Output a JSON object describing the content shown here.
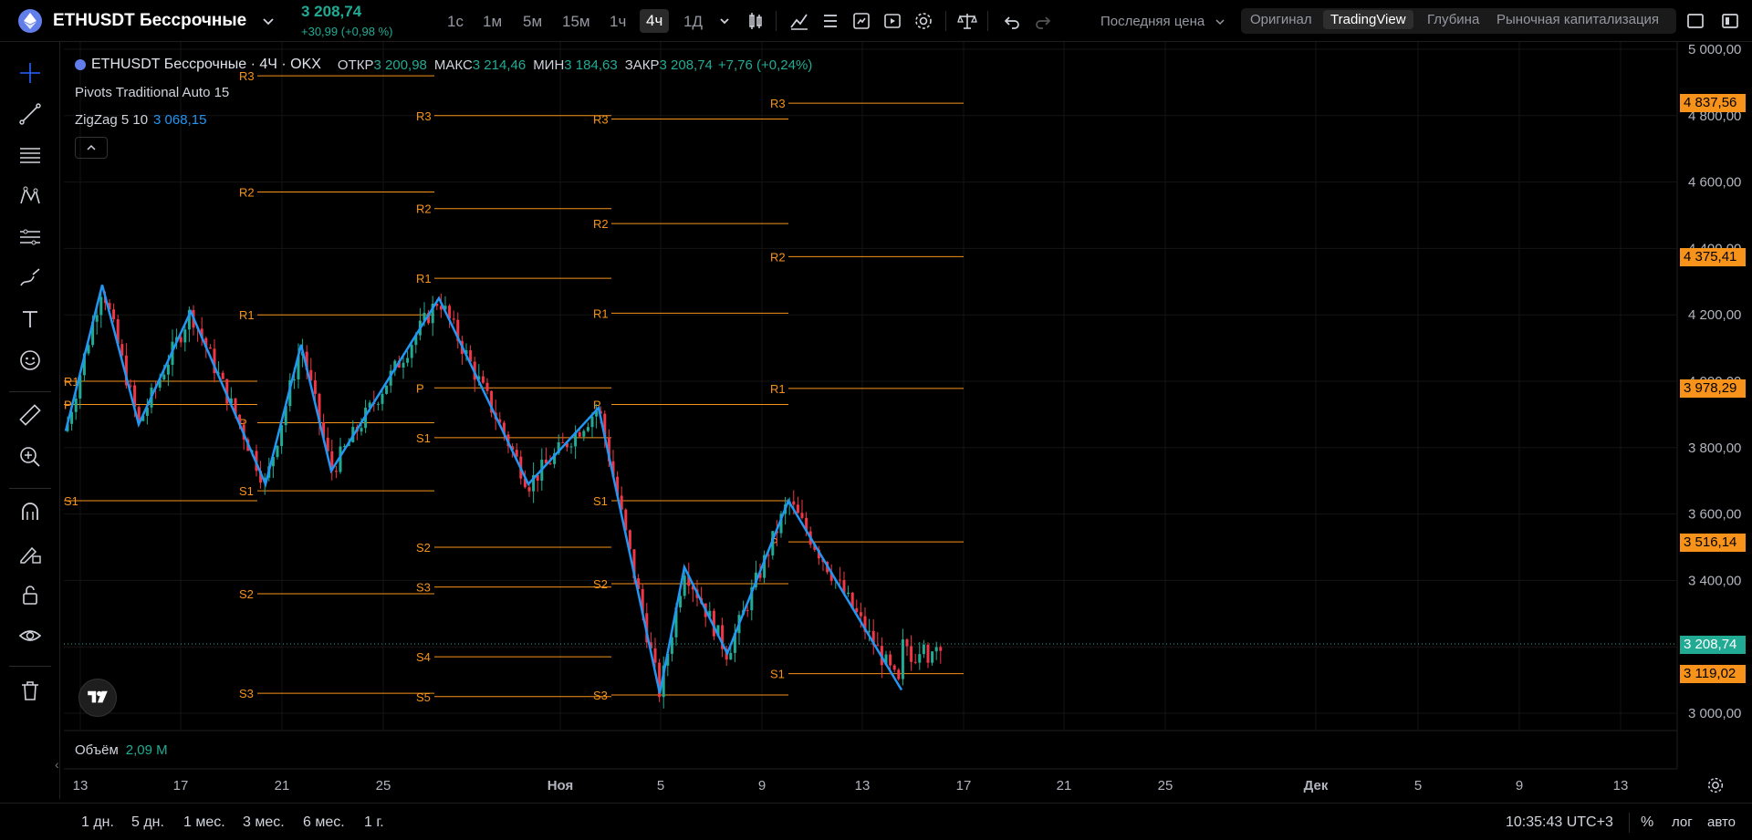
{
  "header": {
    "symbol": "ETHUSDT Бессрочные",
    "last_price": "3 208,74",
    "change": "+30,99 (+0,98 %)",
    "timeframes": [
      "1с",
      "1м",
      "5м",
      "15м",
      "1ч",
      "4ч",
      "1Д"
    ],
    "active_timeframe": "4ч",
    "price_source": "Последняя цена",
    "views": [
      "Оригинал",
      "TradingView",
      "Глубина",
      "Рыночная капитализация"
    ],
    "active_view": "TradingView"
  },
  "legend": {
    "title": "ETHUSDT Бессрочные · 4Ч · OKX",
    "open_label": "ОТКР",
    "open": "3 200,98",
    "high_label": "МАКС",
    "high": "3 214,46",
    "low_label": "МИН",
    "low": "3 184,63",
    "close_label": "ЗАКР",
    "close": "3 208,74",
    "change": "+7,76 (+0,24%)",
    "pivots": "Pivots Traditional Auto 15",
    "zigzag": "ZigZag 5 10",
    "zigzag_value": "3 068,15",
    "volume_label": "Объём",
    "volume_value": "2,09 M"
  },
  "price_axis": {
    "ticks": [
      "5 000,00",
      "4 800,00",
      "4 600,00",
      "4 400,00",
      "4 200,00",
      "4 000,00",
      "3 800,00",
      "3 600,00",
      "3 400,00",
      "3 200,00",
      "3 000,00"
    ],
    "badges": [
      {
        "text": "4 837,56",
        "color": "#f7931a"
      },
      {
        "text": "4 375,41",
        "color": "#f7931a"
      },
      {
        "text": "3 978,29",
        "color": "#f7931a"
      },
      {
        "text": "3 516,14",
        "color": "#f7931a"
      },
      {
        "text": "3 208,74",
        "color": "#22ab94"
      },
      {
        "text": "3 119,02",
        "color": "#f7931a"
      }
    ]
  },
  "time_axis": {
    "ticks": [
      "13",
      "17",
      "21",
      "25",
      "Ноя",
      "5",
      "9",
      "13",
      "17",
      "21",
      "25",
      "Дек",
      "5",
      "9",
      "13"
    ]
  },
  "chart_data": {
    "type": "candlestick",
    "symbol": "ETHUSDT",
    "timeframe": "4ч",
    "y_range": [
      2950,
      5000
    ],
    "pivot_levels": [
      {
        "period": 1,
        "levels": {
          "R1": 4000,
          "P": 3930,
          "S1": 3640
        }
      },
      {
        "period": 2,
        "levels": {
          "R3": 4920,
          "R2": 4570,
          "R1": 4200,
          "P": 3875,
          "S1": 3670,
          "S2": 3360,
          "S3": 3060
        }
      },
      {
        "period": 3,
        "levels": {
          "R3": 4800,
          "R2": 4520,
          "R1": 4310,
          "P": 3980,
          "S1": 3830,
          "S2": 3500,
          "S3": 3380,
          "S4": 3170,
          "S5": 3050
        }
      },
      {
        "period": 4,
        "levels": {
          "R3": 4790,
          "R2": 4475,
          "R1": 4205,
          "P": 3930,
          "S1": 3640,
          "S2": 3390,
          "S3": 3055
        }
      },
      {
        "period": 5,
        "levels": {
          "R3": 4837.56,
          "R2": 4375.41,
          "R1": 3978.29,
          "P": 3516.14,
          "S1": 3119.02
        }
      }
    ],
    "zigzag": [
      3850,
      4290,
      3870,
      4210,
      3690,
      4110,
      3730,
      4250,
      3690,
      3920,
      3060,
      3440,
      3180,
      3640,
      3070
    ],
    "last_price": 3208.74
  },
  "bottom": {
    "ranges": [
      "1 дн.",
      "5 дн.",
      "1 мес.",
      "3 мес.",
      "6 мес.",
      "1 г."
    ],
    "clock": "10:35:43 UTC+3",
    "percent": "%",
    "log": "лог",
    "auto": "авто"
  }
}
